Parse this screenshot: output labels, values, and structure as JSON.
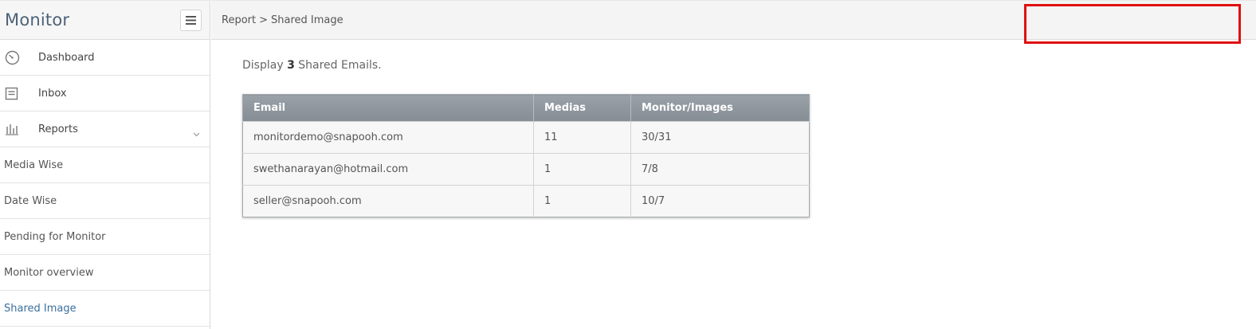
{
  "app": {
    "title": "Monitor"
  },
  "sidebar": {
    "items": [
      {
        "label": "Dashboard",
        "icon": "dashboard-gauge-icon"
      },
      {
        "label": "Inbox",
        "icon": "inbox-icon"
      },
      {
        "label": "Reports",
        "icon": "bar-chart-icon",
        "expanded": true
      }
    ],
    "sub_items": [
      {
        "label": "Media Wise",
        "active": false
      },
      {
        "label": "Date Wise",
        "active": false
      },
      {
        "label": "Pending for Monitor",
        "active": false
      },
      {
        "label": "Monitor overview",
        "active": false
      },
      {
        "label": "Shared Image",
        "active": true
      }
    ]
  },
  "breadcrumb": {
    "parent": "Report",
    "separator": ">",
    "current": "Shared Image"
  },
  "summary": {
    "prefix": "Display",
    "count": "3",
    "suffix": "Shared Emails."
  },
  "table": {
    "headers": [
      "Email",
      "Medias",
      "Monitor/Images"
    ],
    "rows": [
      [
        "monitordemo@snapooh.com",
        "11",
        "30/31"
      ],
      [
        "swethanarayan@hotmail.com",
        "1",
        "7/8"
      ],
      [
        "seller@snapooh.com",
        "1",
        "10/7"
      ]
    ]
  },
  "colors": {
    "brand_text": "#4d6278",
    "active_link": "#3a6f9e",
    "table_header": "#8c939a",
    "highlight_border": "#e01010"
  }
}
